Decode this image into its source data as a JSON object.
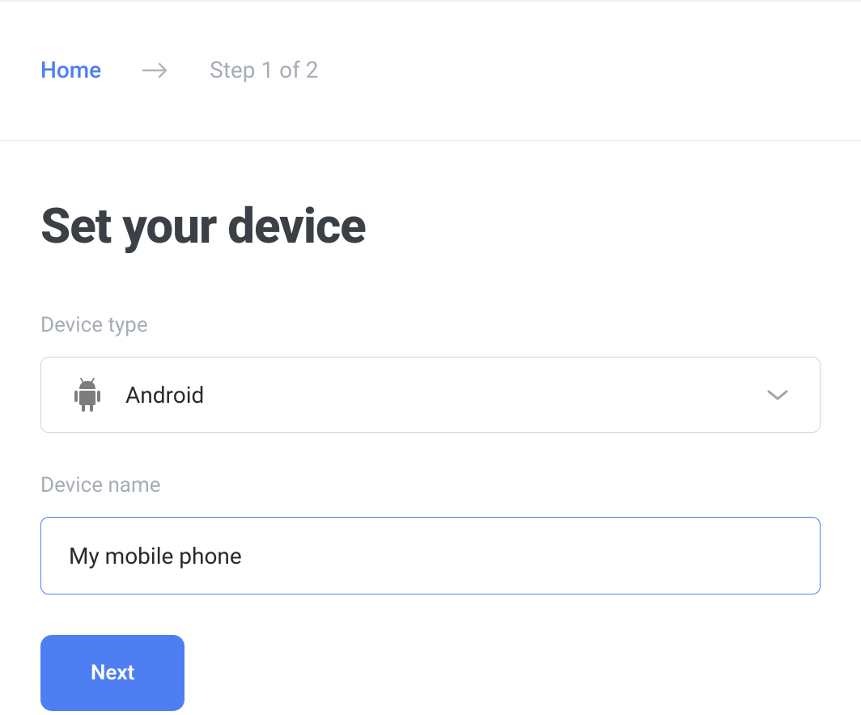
{
  "breadcrumb": {
    "home_label": "Home",
    "step_label": "Step 1 of 2"
  },
  "page": {
    "title": "Set your device"
  },
  "form": {
    "device_type": {
      "label": "Device type",
      "selected": "Android",
      "icon": "android-icon"
    },
    "device_name": {
      "label": "Device name",
      "value": "My mobile phone"
    },
    "next_label": "Next"
  },
  "colors": {
    "accent": "#4d7ef2",
    "text_muted": "#a7adb6",
    "text_dark": "#3b3f46",
    "border": "#d4d4d4"
  }
}
